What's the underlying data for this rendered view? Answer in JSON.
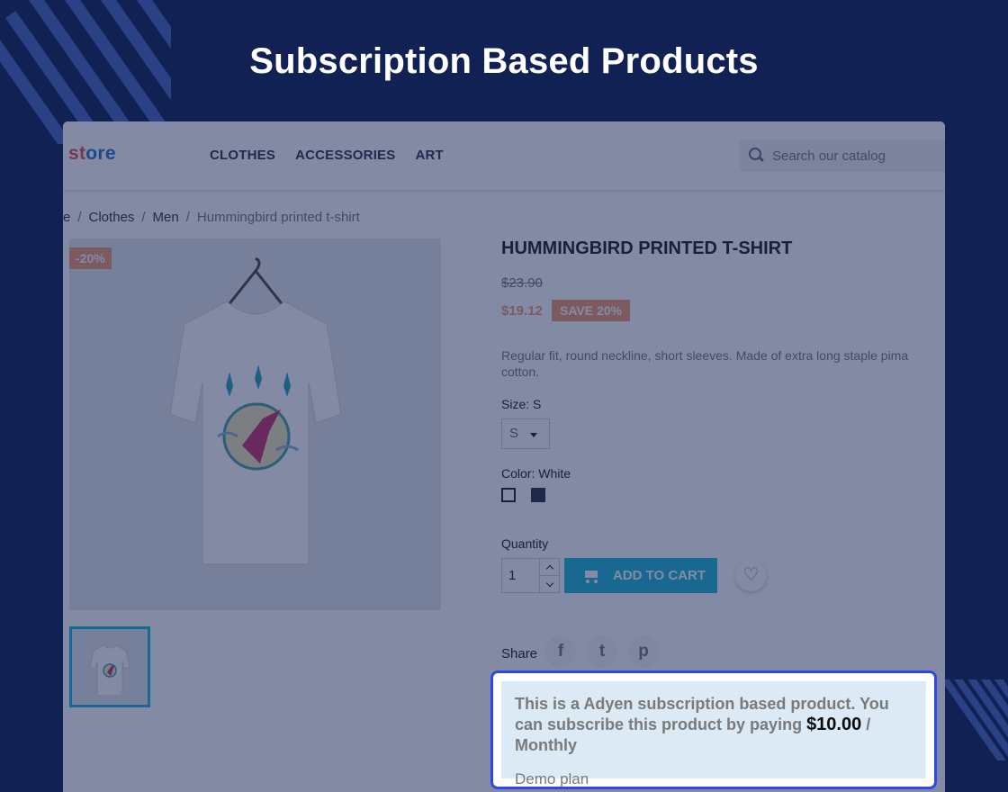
{
  "banner": {
    "title": "Subscription Based Products"
  },
  "store": {
    "logo": {
      "part1": "st",
      "part2": "ore"
    },
    "nav": [
      "CLOTHES",
      "ACCESSORIES",
      "ART"
    ],
    "search_placeholder": "Search our catalog",
    "breadcrumb": [
      "e",
      "Clothes",
      "Men",
      "Hummingbird printed t-shirt"
    ]
  },
  "product": {
    "discount_flag": "-20%",
    "title": "HUMMINGBIRD PRINTED T-SHIRT",
    "old_price": "$23.90",
    "new_price": "$19.12",
    "save_badge": "SAVE 20%",
    "description": "Regular fit, round neckline, short sleeves. Made of extra long staple pima cotton.",
    "size_label": "Size: S",
    "size_value": "S",
    "color_label": "Color: White",
    "quantity_label": "Quantity",
    "quantity_value": "1",
    "add_to_cart": "ADD TO CART",
    "wishlist_icon": "heart-icon",
    "share_label": "Share",
    "share_icons": [
      "f",
      "t",
      "p"
    ]
  },
  "subscription": {
    "text_before": "This is a Adyen subscription based product. You can subscribe this product by paying ",
    "amount": "$10.00",
    "text_after": " / Monthly",
    "plan": "Demo plan"
  },
  "colors": {
    "background": "#122154",
    "accent": "#24b9d7",
    "discount": "#f39d72",
    "highlight_border": "#2f48e0"
  }
}
